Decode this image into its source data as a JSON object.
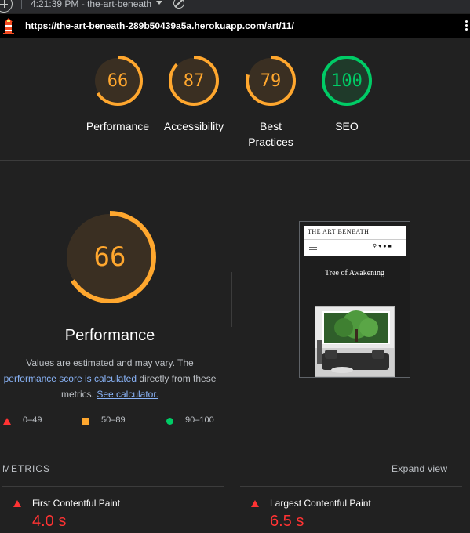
{
  "toolbar": {
    "report_title": "4:21:39 PM - the-art-beneath"
  },
  "url": "https://the-art-beneath-289b50439a5a.herokuapp.com/art/11/",
  "scores": [
    {
      "value": "66",
      "label": "Performance",
      "status": "average"
    },
    {
      "value": "87",
      "label": "Accessibility",
      "status": "average"
    },
    {
      "value": "79",
      "label": "Best\nPractices",
      "status": "average"
    },
    {
      "value": "100",
      "label": "SEO",
      "status": "pass"
    }
  ],
  "performance": {
    "score": "66",
    "title": "Performance",
    "note_prefix": "Values are estimated and may vary. The",
    "note_link": "performance score is calculated",
    "note_mid": "directly from these metrics.",
    "calc_link": "See calculator."
  },
  "legend": [
    {
      "range": "0–49",
      "shape": "triangle"
    },
    {
      "range": "50–89",
      "shape": "square"
    },
    {
      "range": "90–100",
      "shape": "circle"
    }
  ],
  "thumbnail": {
    "brand": "THE ART BENEATH",
    "art_title": "Tree of Awakening"
  },
  "metrics": {
    "heading": "METRICS",
    "expand_label": "Expand view",
    "items": [
      {
        "name": "First Contentful Paint",
        "value": "4.0 s"
      },
      {
        "name": "Largest Contentful Paint",
        "value": "6.5 s"
      }
    ]
  },
  "colors": {
    "average": "#ffa72e",
    "pass": "#0c6",
    "fail": "#ff3333",
    "link": "#8ab4f8"
  }
}
